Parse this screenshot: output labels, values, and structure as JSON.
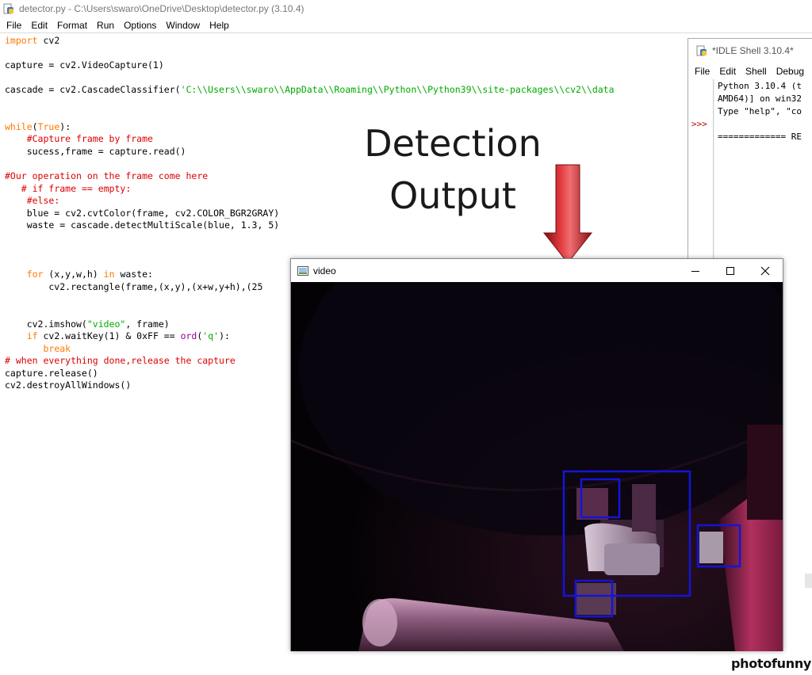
{
  "editor": {
    "title": "detector.py - C:\\Users\\swaro\\OneDrive\\Desktop\\detector.py (3.10.4)",
    "icon": "python-file-icon",
    "menu": [
      "File",
      "Edit",
      "Format",
      "Run",
      "Options",
      "Window",
      "Help"
    ],
    "code_lines": [
      "import cv2",
      "",
      "capture = cv2.VideoCapture(1)",
      "",
      "cascade = cv2.CascadeClassifier('C:\\\\Users\\\\swaro\\\\AppData\\\\Roaming\\\\Python\\\\Python39\\\\site-packages\\\\cv2\\\\data",
      "",
      "",
      "while(True):",
      "    #Capture frame by frame",
      "    sucess,frame = capture.read()",
      "",
      "#Our operation on the frame come here",
      "   # if frame == empty:",
      "    #else:",
      "    blue = cv2.cvtColor(frame, cv2.COLOR_BGR2GRAY)",
      "    waste = cascade.detectMultiScale(blue, 1.3, 5)",
      "",
      "",
      "",
      "    for (x,y,w,h) in waste:",
      "        cv2.rectangle(frame,(x,y),(x+w,y+h),(25",
      "",
      "",
      "    cv2.imshow(\"video\", frame)",
      "    if cv2.waitKey(1) & 0xFF == ord('q'):",
      "       break",
      "# when everything done,release the capture",
      "capture.release()",
      "cv2.destroyAllWindows()"
    ]
  },
  "shell": {
    "title": "*IDLE Shell 3.10.4*",
    "menu": [
      "File",
      "Edit",
      "Shell",
      "Debug"
    ],
    "prompt": ">>>",
    "lines": [
      "Python 3.10.4 (t",
      "AMD64)] on win32",
      "Type \"help\", \"co",
      "",
      "============= RE"
    ]
  },
  "annotation": {
    "line1": "Detection",
    "line2": "Output",
    "arrow_color": "#c0151b"
  },
  "video_window": {
    "title": "video",
    "detection_box_color": "#1414d8",
    "detections_count": 4
  },
  "watermark": "photofunny"
}
